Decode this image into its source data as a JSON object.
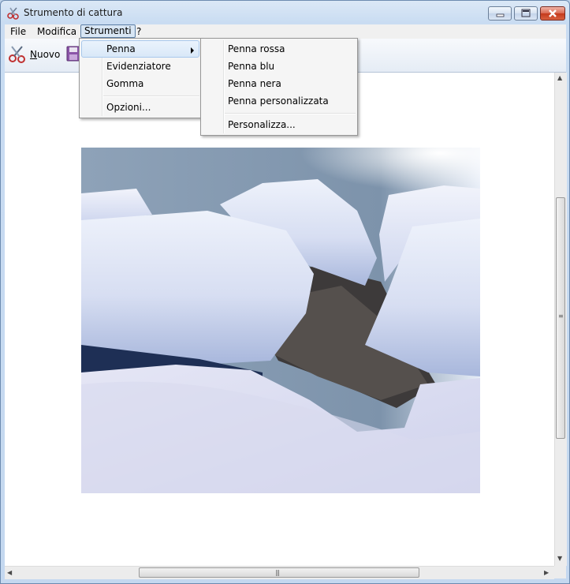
{
  "window": {
    "title": "Strumento di cattura"
  },
  "menubar": {
    "items": [
      {
        "label": "File"
      },
      {
        "label": "Modifica"
      },
      {
        "label": "Strumenti"
      },
      {
        "label": "?"
      }
    ],
    "open_item": "Strumenti"
  },
  "toolbar": {
    "new_label": "Nuovo",
    "new_mnemonic": "N",
    "new_rest": "uovo"
  },
  "tools_menu": {
    "items": [
      {
        "label": "Penna",
        "has_submenu": true
      },
      {
        "label": "Evidenziatore"
      },
      {
        "label": "Gomma"
      },
      {
        "label": "Opzioni..."
      }
    ],
    "highlighted": "Penna"
  },
  "pen_submenu": {
    "items": [
      {
        "label": "Penna rossa"
      },
      {
        "label": "Penna blu"
      },
      {
        "label": "Penna nera"
      },
      {
        "label": "Penna personalizzata"
      },
      {
        "label": "Personalizza..."
      }
    ]
  },
  "icons": {
    "app": "scissors-icon",
    "new": "scissors-icon",
    "save": "floppy-disk-icon",
    "minimize": "minimize-icon",
    "maximize": "maximize-icon",
    "close": "close-icon"
  },
  "colors": {
    "highlight": "#d9e8f8",
    "close_button": "#c4391c"
  }
}
